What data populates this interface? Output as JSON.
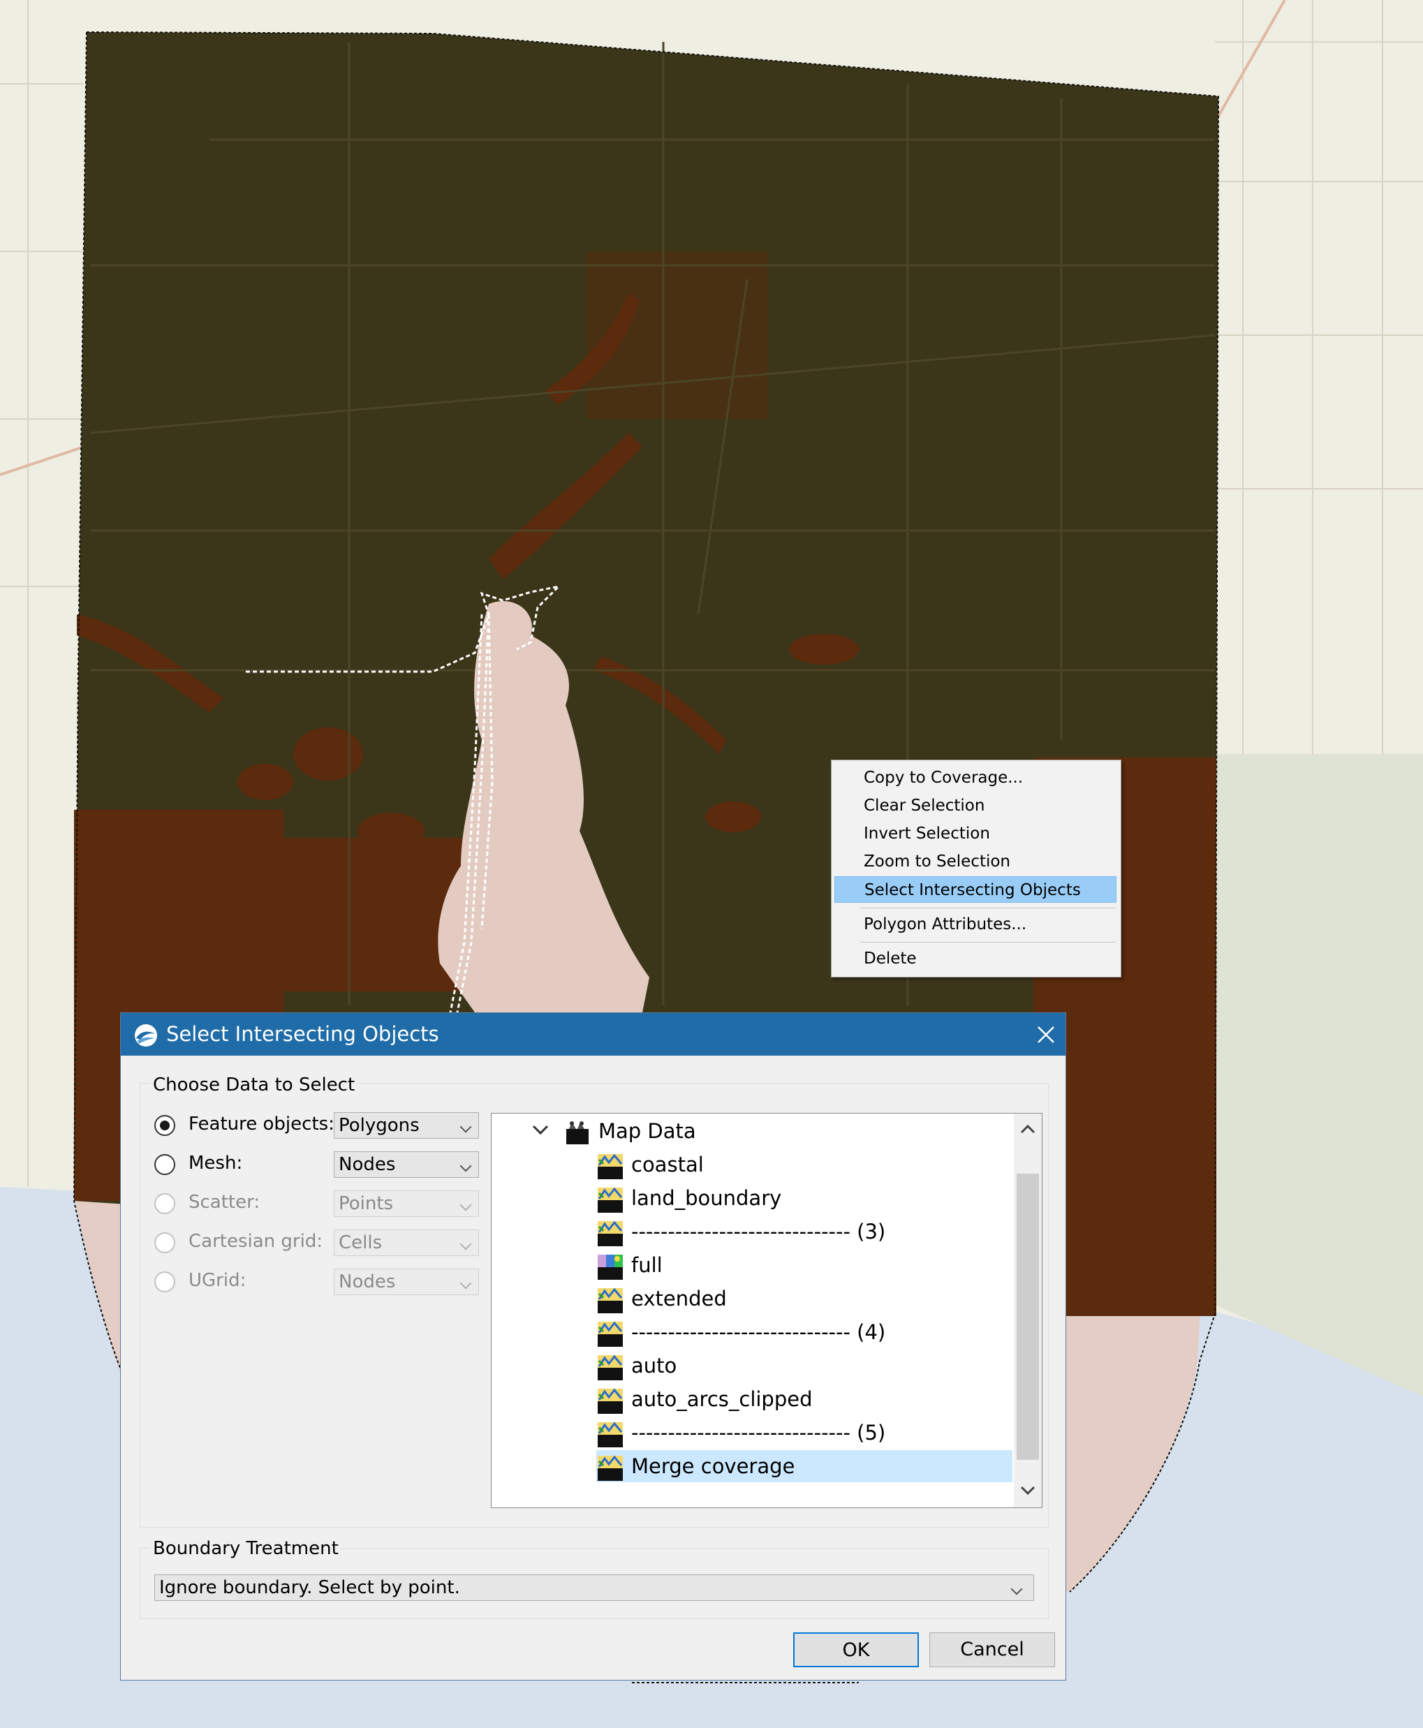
{
  "context_menu": {
    "items": [
      {
        "label": "Copy to Coverage..."
      },
      {
        "label": "Clear Selection"
      },
      {
        "label": "Invert Selection"
      },
      {
        "label": "Zoom to Selection"
      },
      {
        "label": "Select Intersecting Objects",
        "highlighted": true
      },
      {
        "label": "Polygon Attributes..."
      },
      {
        "label": "Delete"
      }
    ]
  },
  "dialog": {
    "title": "Select Intersecting Objects",
    "choose_group_label": "Choose Data to Select",
    "options": [
      {
        "label": "Feature objects:",
        "combo": "Polygons",
        "checked": true,
        "enabled": true
      },
      {
        "label": "Mesh:",
        "combo": "Nodes",
        "checked": false,
        "enabled": true
      },
      {
        "label": "Scatter:",
        "combo": "Points",
        "checked": false,
        "enabled": false
      },
      {
        "label": "Cartesian grid:",
        "combo": "Cells",
        "checked": false,
        "enabled": false
      },
      {
        "label": "UGrid:",
        "combo": "Nodes",
        "checked": false,
        "enabled": false
      }
    ],
    "tree": {
      "root": "Map Data",
      "items": [
        {
          "label": "coastal",
          "icon": "coverage-icon"
        },
        {
          "label": "land_boundary",
          "icon": "coverage-icon"
        },
        {
          "label": "------------------------------ (3)",
          "icon": "coverage-icon"
        },
        {
          "label": "full",
          "icon": "colored-coverage-icon"
        },
        {
          "label": "extended",
          "icon": "coverage-icon"
        },
        {
          "label": "------------------------------ (4)",
          "icon": "coverage-icon"
        },
        {
          "label": "auto",
          "icon": "coverage-icon"
        },
        {
          "label": "auto_arcs_clipped",
          "icon": "coverage-icon"
        },
        {
          "label": "------------------------------ (5)",
          "icon": "coverage-icon"
        },
        {
          "label": "Merge coverage",
          "icon": "coverage-icon",
          "selected": true
        }
      ]
    },
    "boundary_group_label": "Boundary Treatment",
    "boundary_value": "Ignore boundary. Select by point.",
    "ok_label": "OK",
    "cancel_label": "Cancel"
  },
  "colors": {
    "title_bar": "#1f6ca8",
    "menu_highlight": "#99cdf7",
    "map_dark": "#3b3519",
    "map_brown": "#5c2a0c",
    "water": "#d9e3ee",
    "lake": "#e3cbc1"
  }
}
